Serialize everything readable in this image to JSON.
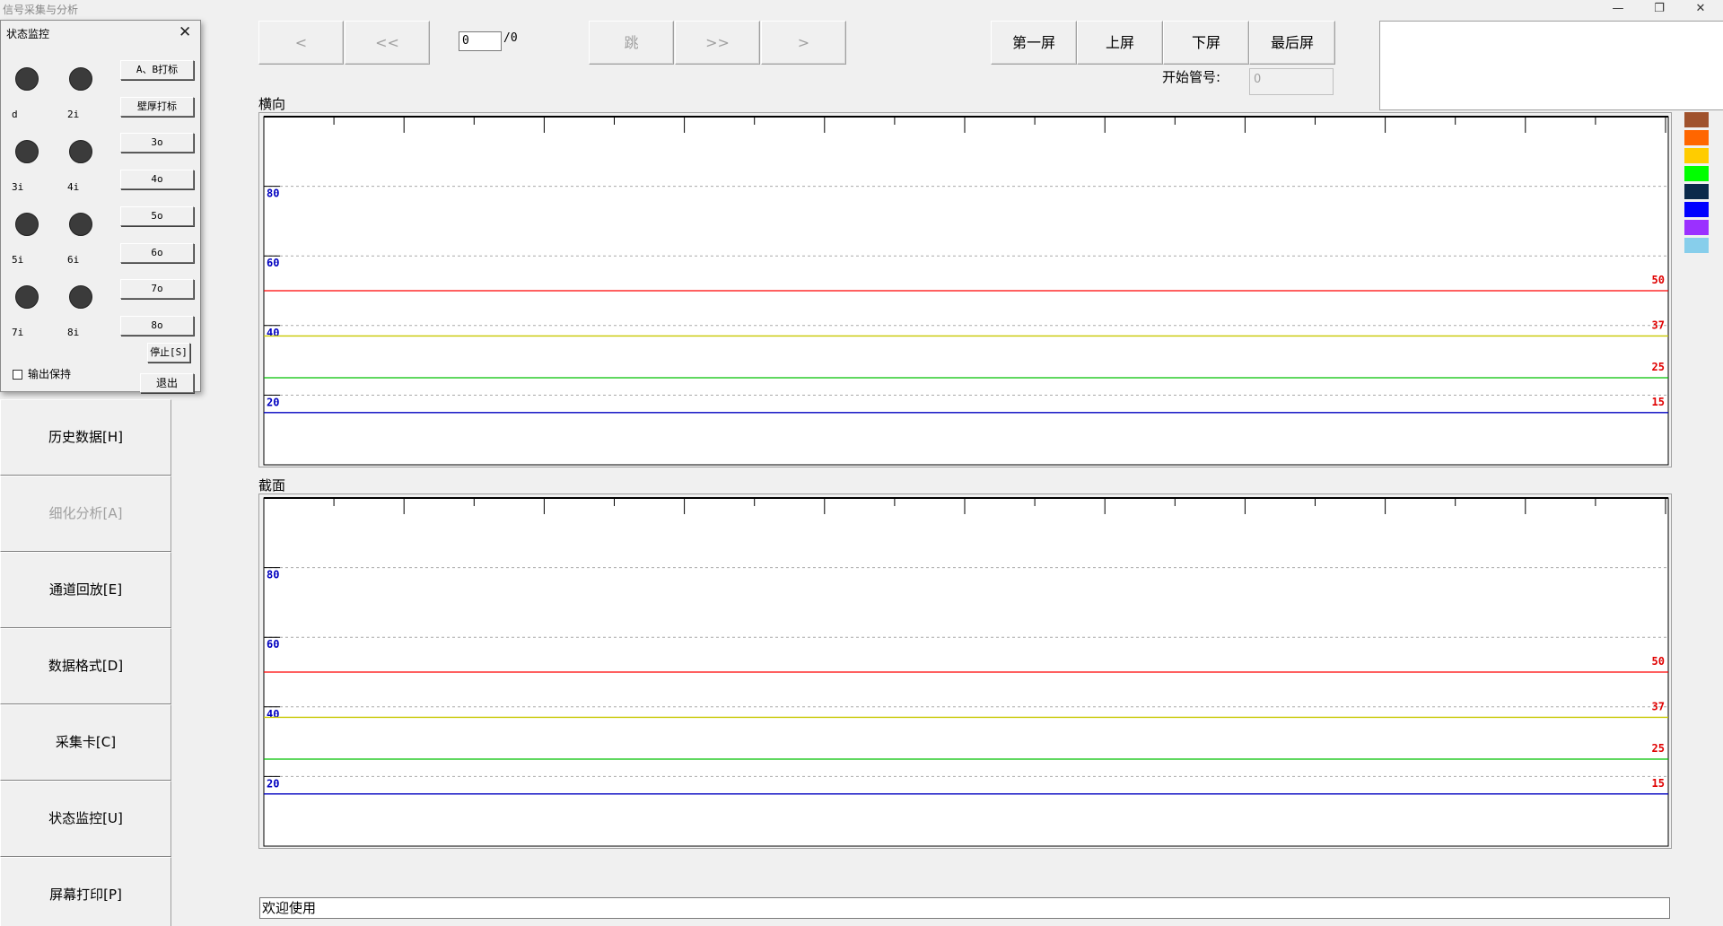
{
  "app": {
    "title": "信号采集与分析"
  },
  "window_controls": {
    "minimize": "—",
    "restore": "❐",
    "close": "✕"
  },
  "nav": {
    "prev": "<",
    "prev_fast": "<<",
    "page_value": "0",
    "page_total": "/0",
    "jump": "跳",
    "next_fast": ">>",
    "next": ">",
    "first_screen": "第一屏",
    "prev_screen": "上屏",
    "next_screen": "下屏",
    "last_screen": "最后屏"
  },
  "start_pipe": {
    "label": "开始管号:",
    "value": "0"
  },
  "charts": [
    {
      "title": "横向"
    },
    {
      "title": "截面"
    }
  ],
  "chart_data": [
    {
      "type": "line",
      "title": "横向",
      "ylim": [
        0,
        100
      ],
      "yticks": [
        20,
        40,
        60,
        80
      ],
      "grid": true,
      "threshold_lines": [
        {
          "value": 50,
          "label": "50",
          "color": "#ff0000"
        },
        {
          "value": 37,
          "label": "37",
          "color": "#c8c800"
        },
        {
          "value": 25,
          "label": "25",
          "color": "#00c000"
        },
        {
          "value": 15,
          "label": "15",
          "color": "#0000c0"
        }
      ],
      "series": []
    },
    {
      "type": "line",
      "title": "截面",
      "ylim": [
        0,
        100
      ],
      "yticks": [
        20,
        40,
        60,
        80
      ],
      "grid": true,
      "threshold_lines": [
        {
          "value": 50,
          "label": "50",
          "color": "#ff0000"
        },
        {
          "value": 37,
          "label": "37",
          "color": "#c8c800"
        },
        {
          "value": 25,
          "label": "25",
          "color": "#00c000"
        },
        {
          "value": 15,
          "label": "15",
          "color": "#0000c0"
        }
      ],
      "series": []
    }
  ],
  "legend_colors": [
    "#a0522d",
    "#ff6600",
    "#ffcc00",
    "#00ff00",
    "#0b2a4a",
    "#0000ff",
    "#9b30ff",
    "#87ceeb"
  ],
  "sidebar": [
    {
      "label": "历史数据[H]",
      "disabled": false
    },
    {
      "label": "细化分析[A]",
      "disabled": true
    },
    {
      "label": "通道回放[E]",
      "disabled": false
    },
    {
      "label": "数据格式[D]",
      "disabled": false
    },
    {
      "label": "采集卡[C]",
      "disabled": false
    },
    {
      "label": "状态监控[U]",
      "disabled": false
    },
    {
      "label": "屏幕打印[P]",
      "disabled": false
    }
  ],
  "status": {
    "text": "欢迎使用"
  },
  "dialog": {
    "title": "状态监控",
    "leds": [
      {
        "label": "d"
      },
      {
        "label": "2i"
      },
      {
        "label": "3i"
      },
      {
        "label": "4i"
      },
      {
        "label": "5i"
      },
      {
        "label": "6i"
      },
      {
        "label": "7i"
      },
      {
        "label": "8i"
      }
    ],
    "buttons": [
      "A、B打标",
      "壁厚打标",
      "3o",
      "4o",
      "5o",
      "6o",
      "7o",
      "8o"
    ],
    "stop": "停止[S]",
    "hold_label": "输出保持",
    "exit": "退出"
  }
}
